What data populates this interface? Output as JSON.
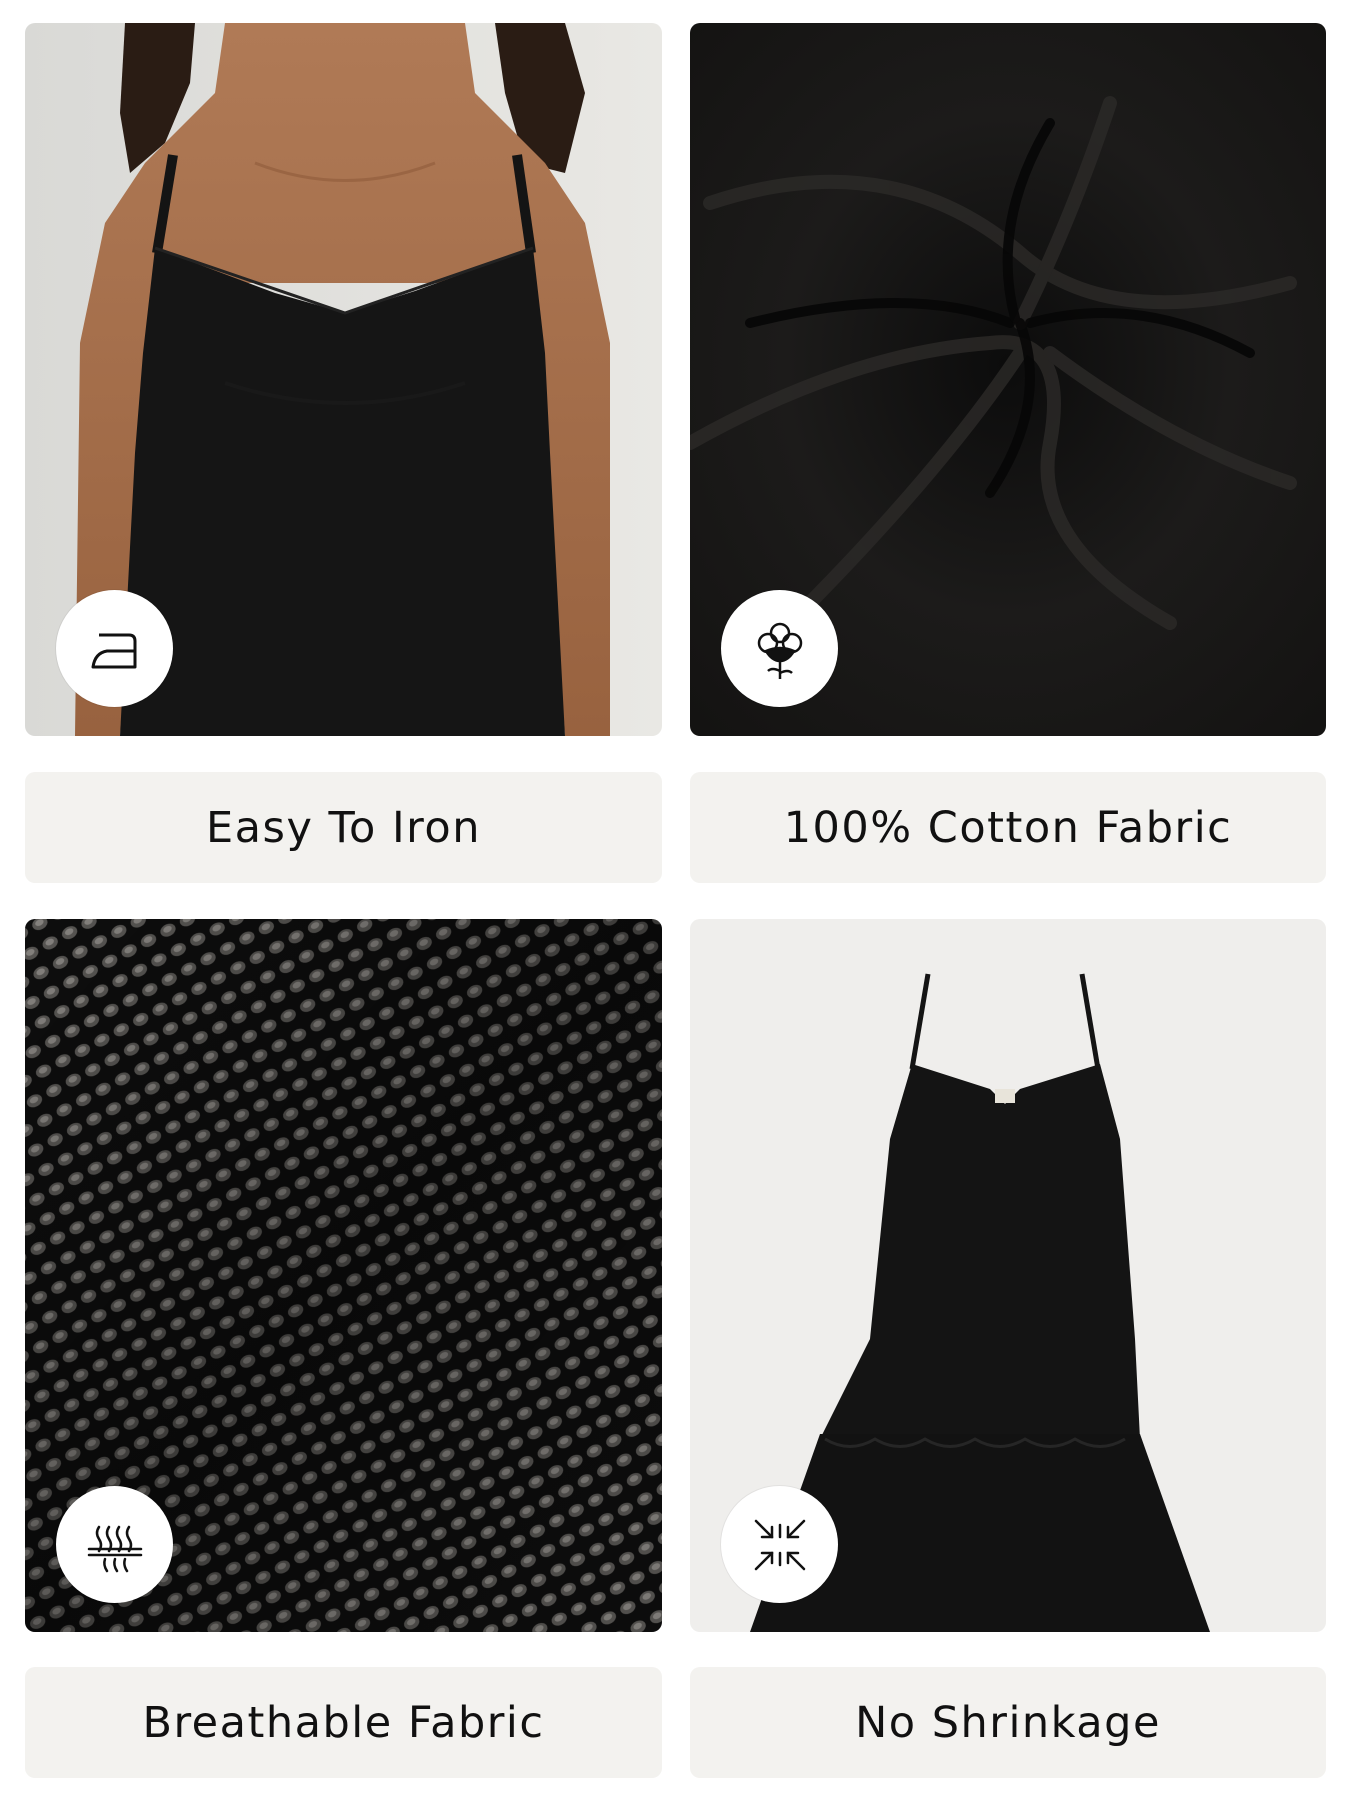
{
  "features": [
    {
      "label": "Easy To Iron",
      "icon": "iron-icon",
      "photo": "model-wearing-black-camisole"
    },
    {
      "label": "100% Cotton Fabric",
      "icon": "cotton-flower-icon",
      "photo": "black-fabric-swirl"
    },
    {
      "label": "Breathable Fabric",
      "icon": "breathable-fabric-icon",
      "photo": "black-knit-texture-closeup"
    },
    {
      "label": "No Shrinkage",
      "icon": "no-shrinkage-icon",
      "photo": "black-tiered-slip-dress"
    }
  ],
  "colors": {
    "label_background": "#f3f2ef",
    "label_text": "#111111",
    "badge_background": "#ffffff",
    "garment": "#141414"
  }
}
